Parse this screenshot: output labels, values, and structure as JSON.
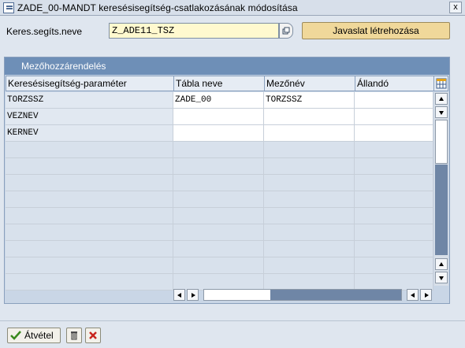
{
  "window": {
    "title": "ZADE_00-MANDT keresésisegítség-csatlakozásának módosítása",
    "close_glyph": "x"
  },
  "form": {
    "label": "Keres.segíts.neve",
    "value": "Z_ADE11_TSZ",
    "propose_button": "Javaslat létrehozása"
  },
  "group": {
    "title": "Mezőhozzárendelés"
  },
  "table": {
    "columns": [
      "Keresésisegítség-paraméter",
      "Tábla neve",
      "Mezőnév",
      "Állandó"
    ],
    "rows": [
      [
        "TORZSSZ",
        "ZADE_00",
        "TORZSSZ",
        ""
      ],
      [
        "VEZNEV",
        "",
        "",
        ""
      ],
      [
        "KERNEV",
        "",
        "",
        ""
      ]
    ],
    "empty_rows": 9
  },
  "toolbar": {
    "accept_label": "Átvétel"
  },
  "icons": {
    "title": "change-dialog-icon",
    "f4": "value-help-icon",
    "settings": "table-settings-icon",
    "accept": "checkmark-icon",
    "delete": "trash-icon",
    "cancel": "cancel-icon"
  },
  "colors": {
    "group_header": "#6e8fb7",
    "input_required": "#fff9cf",
    "propose_button": "#f0d89a",
    "accept_check": "#3a8a1e",
    "cancel_x": "#c8241c"
  }
}
